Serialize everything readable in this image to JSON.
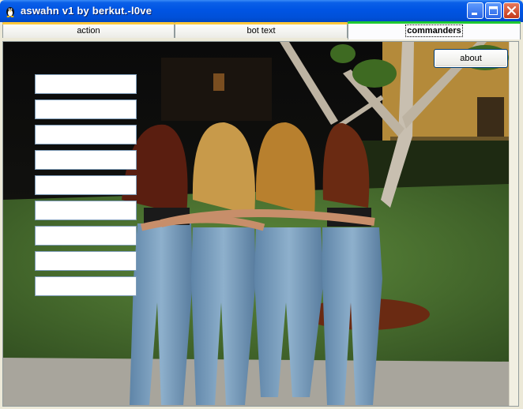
{
  "window": {
    "title": "aswahn v1 by berkut.-l0ve",
    "app_icon": "tux-penguin-icon",
    "controls": [
      "minimize-icon",
      "maximize-icon",
      "close-icon"
    ]
  },
  "tabs": [
    {
      "label": "action",
      "selected": false
    },
    {
      "label": "bot text",
      "selected": false
    },
    {
      "label": "commanders",
      "selected": true
    }
  ],
  "content": {
    "about_label": "about",
    "command_inputs": [
      "",
      "",
      "",
      "",
      "",
      "",
      "",
      "",
      ""
    ]
  },
  "colors": {
    "titlebar": "#0054E3",
    "tab_hover_accent": "#FFC83C",
    "tab_selected_accent": "#1EC832",
    "window_face": "#ECE9D8"
  }
}
